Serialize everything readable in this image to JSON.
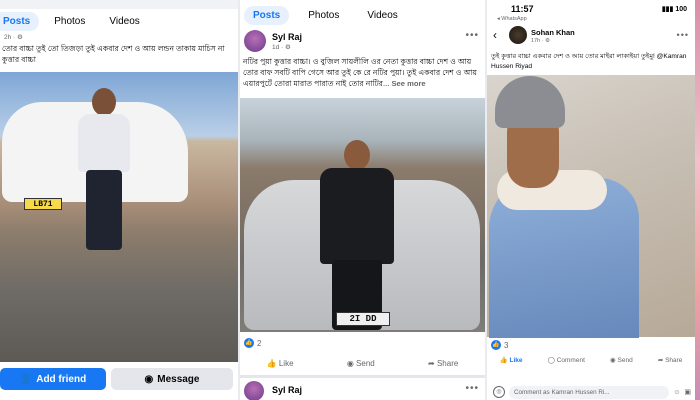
{
  "panel1": {
    "tabs": [
      "Posts",
      "Photos",
      "Videos"
    ],
    "active_tab": "Posts",
    "meta": "2h · ⚙",
    "caption": "তোর বাচ্চা তুই তো তিজড়া তুই একবার দেশ ও আয় লন্ডন তাকায় মাচিস না কুত্তার বাচ্চা",
    "plate": "LB71",
    "add_friend_label": "Add friend",
    "message_label": "Message"
  },
  "panel2": {
    "tabs": [
      "Posts",
      "Photos",
      "Videos"
    ],
    "active_tab": "Posts",
    "author": "Syl Raj",
    "meta": "1d · ⚙",
    "caption": "নটির পুয়া কুত্তার বাচ্চা। ও বুজিল সায়লীলি ওর নেতা কুত্তার বাচ্চা দেশ ও আয় তোর বাফ সবটি বাপি গেসে আর তুই কে রে নটির পুয়া। তুই একবার দেশ ও আয় এয়ারপুর্টে তোরা মারাত পারাত নাই তোর নাটির...",
    "see_more": "See more",
    "plate": "2I  DD",
    "reaction_count": "2",
    "like_label": "Like",
    "send_label": "Send",
    "share_label": "Share",
    "second_author": "Syl Raj"
  },
  "panel3": {
    "time": "11:57",
    "back_app": "◂ WhatsApp",
    "signal": "▮▮▮ 100",
    "author": "Sohan Khan",
    "meta": "17h · ⚙",
    "caption": "তুই কুত্তার বাচ্চা একবার দেশ ও আয় তোর মাইরা লাকাইয়া তুইমু! @Kamran Hussen Riyad",
    "reaction_count": "3",
    "like_label": "Like",
    "comment_label": "Comment",
    "send_label": "Send",
    "share_label": "Share",
    "comment_placeholder": "Comment as Kamran Hussen Ri..."
  },
  "icons": {
    "accent": "#1877f2",
    "like": "thumbs-up-icon",
    "send": "messenger-icon",
    "share": "share-icon",
    "comment": "comment-icon"
  }
}
